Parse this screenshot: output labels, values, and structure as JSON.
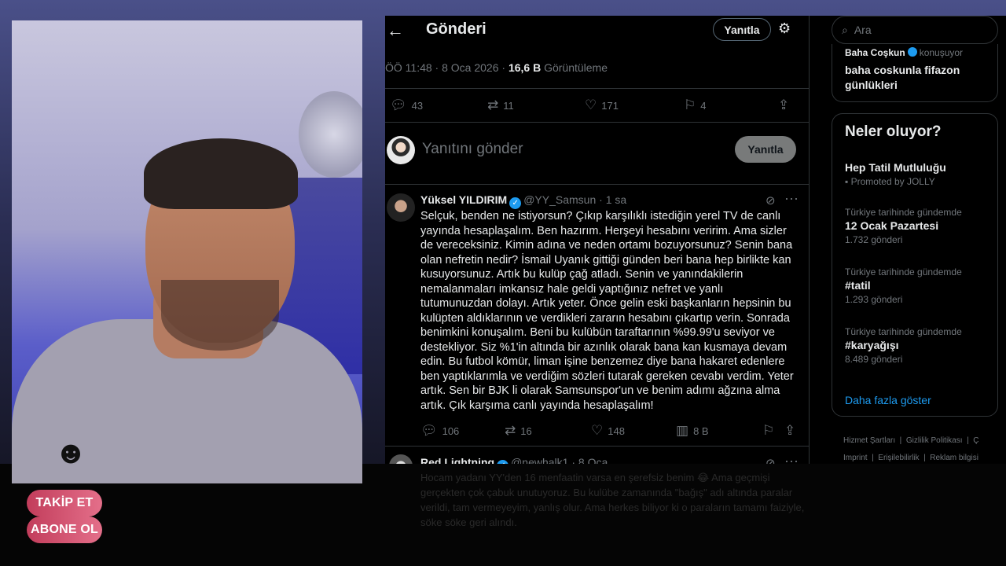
{
  "overlay": {
    "follow_label": "TAKİP ET",
    "subscribe_label": "ABONE OL"
  },
  "header": {
    "title": "Gönderi",
    "reply_button": "Yanıtla"
  },
  "post_meta": {
    "time": "ÖÖ 11:48 · 8 Oca 2026 · ",
    "views_count": "16,6 B",
    "views_label": " Görüntüleme"
  },
  "post_actions": {
    "replies": "43",
    "reposts": "11",
    "likes": "171",
    "bookmarks": "4"
  },
  "compose": {
    "placeholder": "Yanıtını gönder",
    "button": "Yanıtla"
  },
  "reply_tweet": {
    "name": "Yüksel YILDIRIM",
    "handle": "@YY_Samsun · 1 sa",
    "text": "Selçuk, benden ne istiyorsun? Çıkıp karşılıklı istediğin yerel TV de canlı yayında hesaplaşalım. Ben hazırım. Herşeyi hesabını veririm. Ama sizler de vereceksiniz. Kimin adına ve neden ortamı bozuyorsunuz? Senin bana olan nefretin nedir? İsmail Uyanık gittiği günden beri bana hep birlikte kan kusuyorsunuz. Artık bu kulüp çağ atladı. Senin ve yanındakilerin nemalanmaları imkansız hale geldi yaptığınız nefret ve yanlı tutumunuzdan dolayı. Artık yeter. Önce gelin eski başkanların hepsinin bu kulüpten aldıklarının ve verdikleri zararın hesabını çıkartıp verin. Sonrada benimkini konuşalım. Beni bu kulübün taraftarının %99.99'u seviyor ve destekliyor. Siz %1'in altında bir azınlık olarak bana kan kusmaya devam edin. Bu futbol kömür, liman işine benzemez diye bana hakaret edenlere ben yaptıklarımla ve verdiğim sözleri tutarak gereken cevabı verdim. Yeter artık. Sen bir BJK li olarak Samsunspor'un ve benim adımı ağzına alma artık. Çık karşıma canlı yayında hesaplaşalım!",
    "replies": "106",
    "reposts": "16",
    "likes": "148",
    "views": "8 B"
  },
  "next_tweet": {
    "name": "Red Lightning",
    "handle": "@newhalk1 · 8 Oca",
    "text_faded": "Hocam yadanı YY'den 16 menfaatin varsa en şerefsiz benim 😂 Ama geçmişi gerçekten çok çabuk unutuyoruz. Bu kulübe zamanında \"bağış\" adı altında paralar verildi, tam vermeyeyim, yanlış olur. Ama herkes biliyor ki o paraların tamamı faiziyle, söke söke geri alındı."
  },
  "sidebar": {
    "search_placeholder": "Ara",
    "space_user": "Baha Coşkun",
    "space_status": "konuşuyor",
    "space_title": "baha coskunla fifazon günlükleri",
    "trends_heading": "Neler oluyor?",
    "trends": [
      {
        "context": "",
        "title": "Hep Tatil Mutluluğu",
        "count": "Promoted by JOLLY"
      },
      {
        "context": "Türkiye tarihinde gündemde",
        "title": "12 Ocak Pazartesi",
        "count": "1.732 gönderi"
      },
      {
        "context": "Türkiye tarihinde gündemde",
        "title": "#tatil",
        "count": "1.293 gönderi"
      },
      {
        "context": "Türkiye tarihinde gündemde",
        "title": "#karyağışı",
        "count": "8.489 gönderi"
      }
    ],
    "show_more": "Daha fazla göster",
    "footer": [
      "Hizmet Şartları",
      "Gizlilik Politikası",
      "Ç",
      "Imprint",
      "Erişilebilirlik",
      "Reklam bilgisi"
    ]
  },
  "colors": {
    "accent": "#1d9bf0",
    "cta": "#d2506e",
    "background": "#000000"
  }
}
